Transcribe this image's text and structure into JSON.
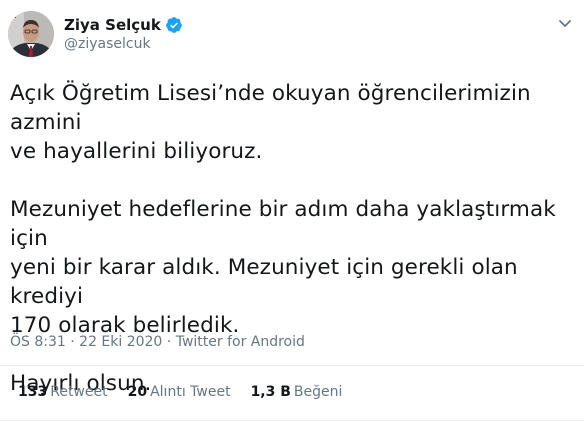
{
  "author": {
    "display_name": "Ziya Selçuk",
    "handle": "@ziyaselcuk",
    "verified": true
  },
  "tweet": {
    "paragraphs": [
      "Açık Öğretim Lisesi’nde okuyan öğrencilerimizin azmini\nve hayallerini biliyoruz.",
      "Mezuniyet hedeflerine bir adım daha yaklaştırmak için\nyeni bir karar aldık. Mezuniyet için gerekli olan krediyi\n170 olarak belirledik.",
      "Hayırlı olsun."
    ],
    "time": "ÖS 8:31",
    "separator": " · ",
    "date": "22 Eki 2020",
    "source": "Twitter for Android"
  },
  "stats": {
    "retweets": {
      "count": "133",
      "label": "Retweet"
    },
    "quotes": {
      "count": "20",
      "label": "Alıntı Tweet"
    },
    "likes": {
      "count": "1,3 B",
      "label": "Beğeni"
    }
  },
  "colors": {
    "text": "#14171a",
    "secondary": "#657786",
    "verified_blue": "#1da1f2",
    "divider": "#e6ecf0"
  },
  "icons": {
    "verified": "verified-badge-icon",
    "menu": "chevron-down-icon"
  }
}
